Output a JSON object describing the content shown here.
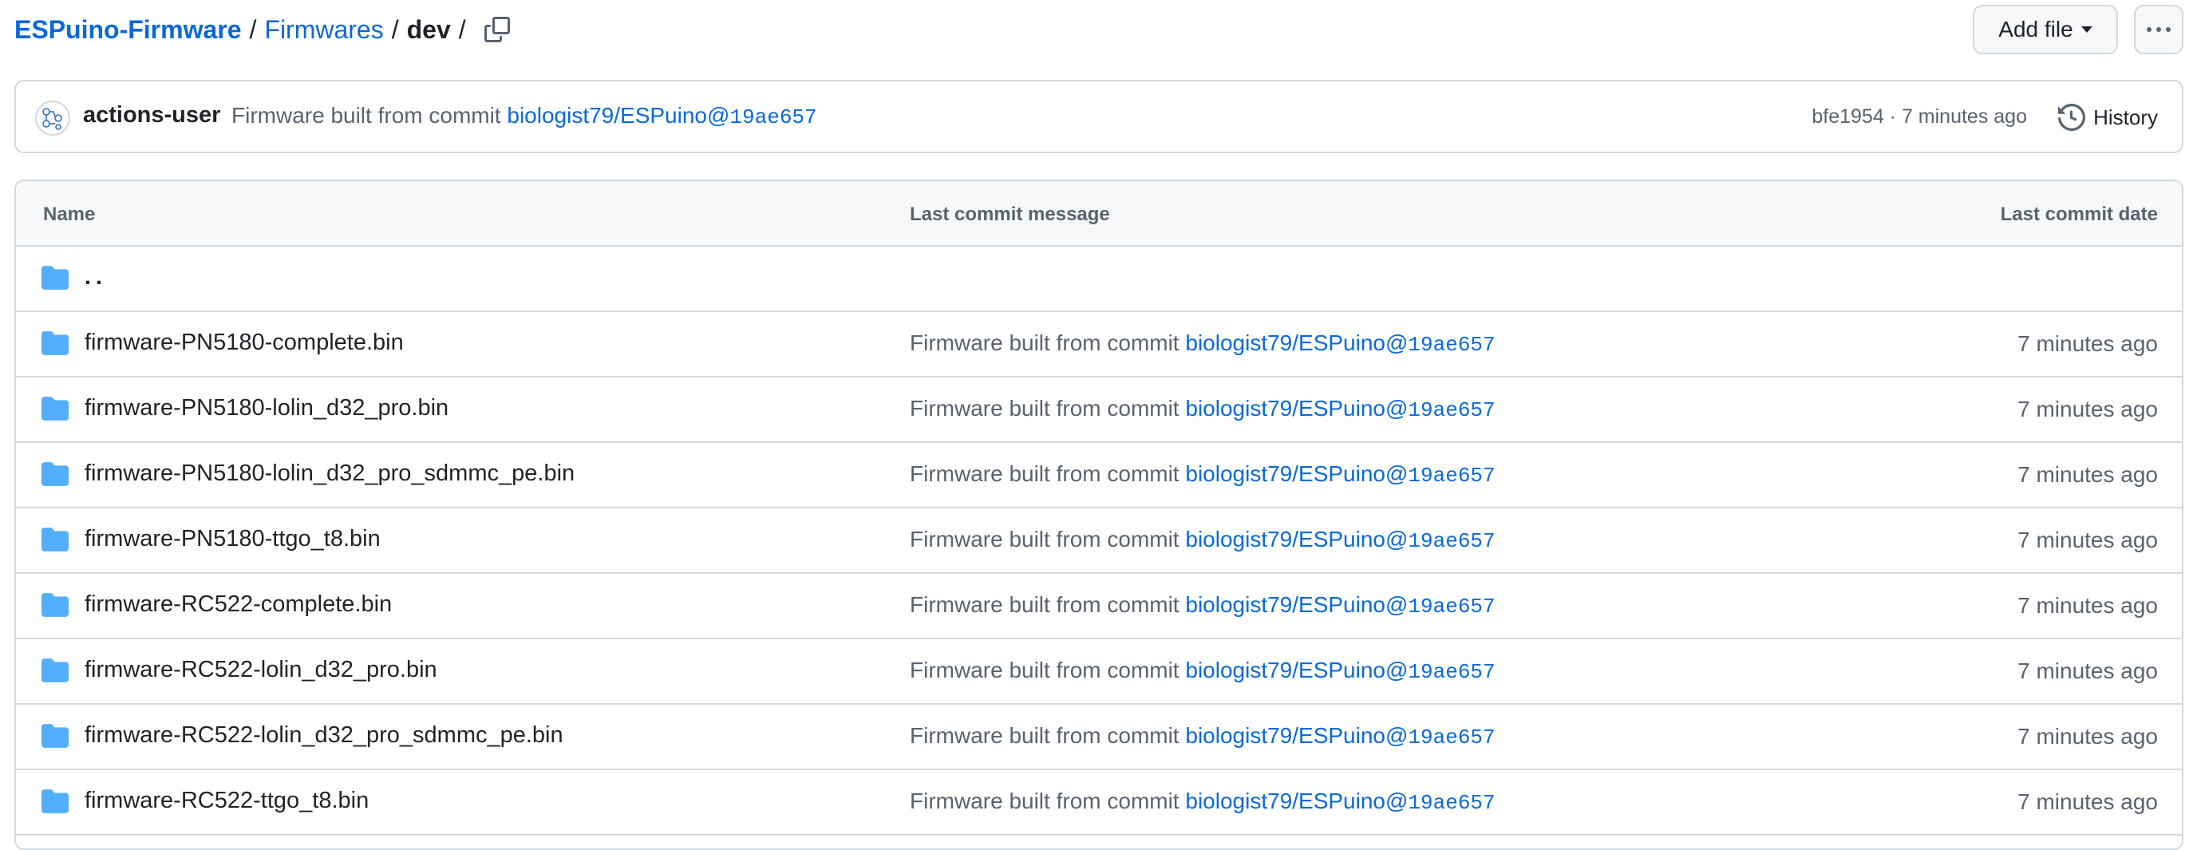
{
  "breadcrumb": {
    "repo": "ESPuino-Firmware",
    "folder": "Firmwares",
    "current": "dev",
    "separator": "/"
  },
  "toolbar": {
    "add_file_label": "Add file",
    "more_icon": "kebab-horizontal-icon",
    "copy_icon": "copy-icon"
  },
  "latest_commit": {
    "author": "actions-user",
    "message_prefix": "Firmware built from commit",
    "commit_ref": "biologist79/ESPuino@",
    "commit_hash": "19ae657",
    "meta": "bfe1954 · 7 minutes ago",
    "history_label": "History"
  },
  "table": {
    "columns": {
      "name": "Name",
      "message": "Last commit message",
      "date": "Last commit date"
    },
    "parent": "..",
    "rows": [
      {
        "name": "firmware-PN5180-complete.bin",
        "msg_prefix": "Firmware built from commit",
        "ref": "biologist79/ESPuino@",
        "hash": "19ae657",
        "date": "7 minutes ago"
      },
      {
        "name": "firmware-PN5180-lolin_d32_pro.bin",
        "msg_prefix": "Firmware built from commit",
        "ref": "biologist79/ESPuino@",
        "hash": "19ae657",
        "date": "7 minutes ago"
      },
      {
        "name": "firmware-PN5180-lolin_d32_pro_sdmmc_pe.bin",
        "msg_prefix": "Firmware built from commit",
        "ref": "biologist79/ESPuino@",
        "hash": "19ae657",
        "date": "7 minutes ago"
      },
      {
        "name": "firmware-PN5180-ttgo_t8.bin",
        "msg_prefix": "Firmware built from commit",
        "ref": "biologist79/ESPuino@",
        "hash": "19ae657",
        "date": "7 minutes ago"
      },
      {
        "name": "firmware-RC522-complete.bin",
        "msg_prefix": "Firmware built from commit",
        "ref": "biologist79/ESPuino@",
        "hash": "19ae657",
        "date": "7 minutes ago"
      },
      {
        "name": "firmware-RC522-lolin_d32_pro.bin",
        "msg_prefix": "Firmware built from commit",
        "ref": "biologist79/ESPuino@",
        "hash": "19ae657",
        "date": "7 minutes ago"
      },
      {
        "name": "firmware-RC522-lolin_d32_pro_sdmmc_pe.bin",
        "msg_prefix": "Firmware built from commit",
        "ref": "biologist79/ESPuino@",
        "hash": "19ae657",
        "date": "7 minutes ago"
      },
      {
        "name": "firmware-RC522-ttgo_t8.bin",
        "msg_prefix": "Firmware built from commit",
        "ref": "biologist79/ESPuino@",
        "hash": "19ae657",
        "date": "7 minutes ago"
      }
    ]
  },
  "colors": {
    "link": "#0969da",
    "folder": "#54aeff",
    "border": "#d1d9e0",
    "muted": "#59636e"
  }
}
